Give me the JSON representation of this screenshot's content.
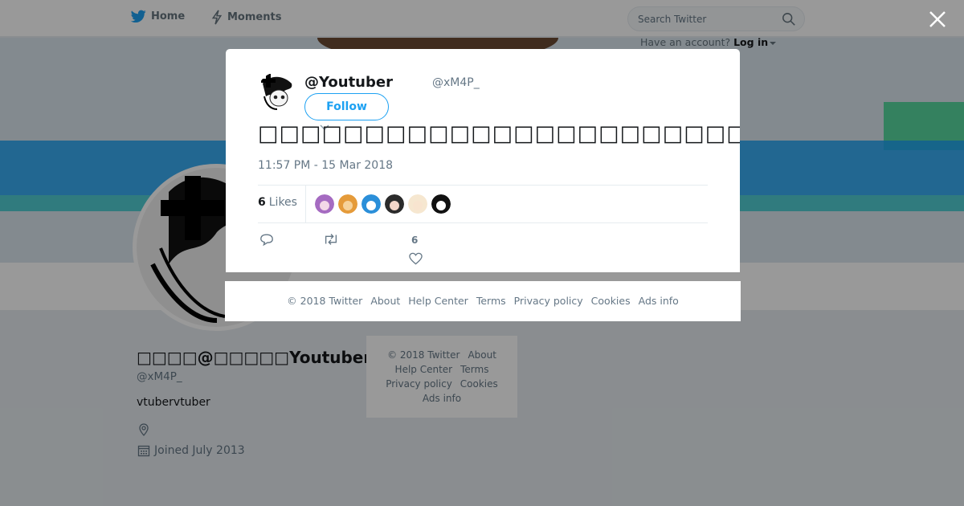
{
  "nav": {
    "home": "Home",
    "moments": "Moments"
  },
  "search": {
    "placeholder": "Search Twitter"
  },
  "account": {
    "prompt": "Have an account?",
    "login": "Log in"
  },
  "profile": {
    "name": "□□□□@□□□□□Youtuber",
    "handle": "@xM4P_",
    "bio": "vtubervtuber",
    "joined": "Joined July 2013"
  },
  "side_footer": [
    "© 2018 Twitter",
    "About",
    "Help Center",
    "Terms",
    "Privacy policy",
    "Cookies",
    "Ads info"
  ],
  "tweet": {
    "name": "@Youtuber",
    "handle": "@xM4P_",
    "follow_label": "Follow",
    "text": "□□□□□□□□□□□□□□□□□□□□□□□□□□□□□□□□□",
    "timestamp": "11:57 PM - 15 Mar 2018",
    "likes_count": "6",
    "likes_label": "Likes",
    "like_action_count": "6",
    "likers": [
      {
        "color": "#a56bc1",
        "face": "#f3d7e8"
      },
      {
        "color": "#e59b3a",
        "face": "#f6d29a"
      },
      {
        "color": "#2b8fd9",
        "face": "#ffffff"
      },
      {
        "color": "#2b2b2b",
        "face": "#f3d6c9"
      },
      {
        "color": "#f6e7d0",
        "face": "#f8e4cf"
      },
      {
        "color": "#111111",
        "face": "#ffffff"
      }
    ]
  },
  "modal_footer": [
    "© 2018 Twitter",
    "About",
    "Help Center",
    "Terms",
    "Privacy policy",
    "Cookies",
    "Ads info"
  ],
  "colors": {
    "brand": "#1da1f2",
    "muted": "#657786",
    "text": "#14171a"
  }
}
